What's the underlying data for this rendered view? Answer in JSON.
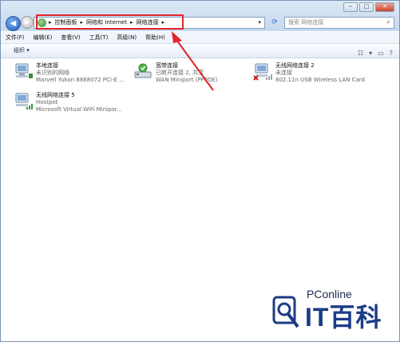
{
  "address": {
    "crumbs": [
      "控制面板",
      "网络和 Internet",
      "网络连接"
    ]
  },
  "search": {
    "placeholder": "搜索 网络连接"
  },
  "menu": [
    "文件(F)",
    "编辑(E)",
    "查看(V)",
    "工具(T)",
    "高级(N)",
    "帮助(H)"
  ],
  "toolbar": {
    "organize": "组织 ▾"
  },
  "connections": [
    {
      "name": "本地连接",
      "status": "未识别的网络",
      "device": "Marvell Yukon 88E8072 PCI-E ..."
    },
    {
      "name": "宽带连接",
      "status": "已断开连接 2, 共享",
      "device": "WAN Miniport (PPPOE)"
    },
    {
      "name": "无线网络连接 2",
      "status": "未连接",
      "device": "802.11n USB Wireless LAN Card"
    },
    {
      "name": "无线网络连接 5",
      "status": "Hostpot",
      "device": "Microsoft Virtual WiFi Minipor..."
    }
  ],
  "watermark": {
    "brand": "PConline",
    "text": "IT百科"
  },
  "colors": {
    "annotation": "#e2262a",
    "brand": "#1c3c85"
  }
}
